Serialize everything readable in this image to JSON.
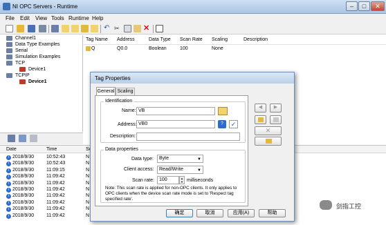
{
  "window": {
    "title": "NI OPC Servers - Runtime"
  },
  "menu": [
    "File",
    "Edit",
    "View",
    "Tools",
    "Runtime",
    "Help"
  ],
  "tree": {
    "items": [
      "Channel1",
      "Data Type Examples",
      "Serial",
      "Simulation Examples",
      "TCP",
      "Device1",
      "TCPIP",
      "Device1"
    ]
  },
  "table": {
    "headers": [
      "Tag Name",
      "Address",
      "Data Type",
      "Scan Rate",
      "Scaling",
      "Description"
    ],
    "row": {
      "name": "Q",
      "address": "Q0.0",
      "type": "Boolean",
      "scan": "100",
      "scaling": "None"
    }
  },
  "log": {
    "headers": [
      "Date",
      "Time",
      "So"
    ],
    "rows": [
      {
        "date": "2018/9/30",
        "time": "10:52:43",
        "src": "N"
      },
      {
        "date": "2018/9/30",
        "time": "10:52:43",
        "src": "N"
      },
      {
        "date": "2018/9/30",
        "time": "11:09:15",
        "src": "N"
      },
      {
        "date": "2018/9/30",
        "time": "11:09:42",
        "src": "N"
      },
      {
        "date": "2018/9/30",
        "time": "11:09:42",
        "src": "N"
      },
      {
        "date": "2018/9/30",
        "time": "11:09:42",
        "src": "N"
      },
      {
        "date": "2018/9/30",
        "time": "11:09:42",
        "src": "N"
      },
      {
        "date": "2018/9/30",
        "time": "11:09:42",
        "src": "N"
      },
      {
        "date": "2018/9/30",
        "time": "11:09:42",
        "src": "N"
      },
      {
        "date": "2018/9/30",
        "time": "11:09:42",
        "src": "N"
      }
    ]
  },
  "dialog": {
    "title": "Tag Properties",
    "tabs": [
      "General",
      "Scaling"
    ],
    "identification": {
      "group_label": "Identification",
      "name_label": "Name:",
      "name_value": "VB",
      "address_label": "Address:",
      "address_value": "VB0",
      "description_label": "Description:",
      "description_value": ""
    },
    "properties": {
      "group_label": "Data properties",
      "datatype_label": "Data type:",
      "datatype_value": "Byte",
      "access_label": "Client access:",
      "access_value": "Read/Write",
      "scanrate_label": "Scan rate:",
      "scanrate_value": "100",
      "scanrate_unit": "milliseconds",
      "note": "Note: This scan rate is applied for non-OPC clients. It only applies to OPC clients when the device scan rate mode is set to 'Respect tag specified rate'."
    },
    "buttons": {
      "ok": "确定",
      "cancel": "取消",
      "apply": "应用(A)",
      "help": "帮助"
    }
  },
  "watermark": {
    "text": "剑指工控"
  },
  "colors": {
    "titlebar": "#b8cfe8",
    "close": "#c8432f",
    "accent": "#2d6bd0"
  }
}
